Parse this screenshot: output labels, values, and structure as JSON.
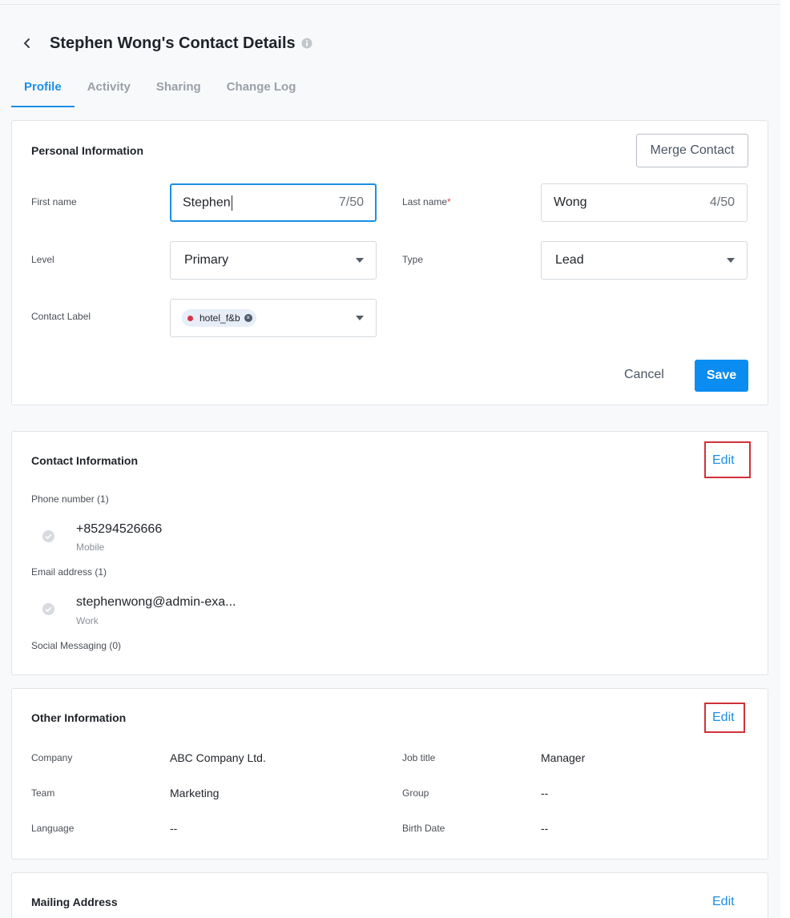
{
  "header": {
    "title": "Stephen Wong's Contact Details"
  },
  "tabs": [
    {
      "label": "Profile",
      "active": true
    },
    {
      "label": "Activity"
    },
    {
      "label": "Sharing"
    },
    {
      "label": "Change Log"
    }
  ],
  "personal": {
    "title": "Personal Information",
    "merge_label": "Merge Contact",
    "first_name": {
      "label": "First name",
      "value": "Stephen",
      "count": "7/50"
    },
    "last_name": {
      "label": "Last name",
      "required": "*",
      "value": "Wong",
      "count": "4/50"
    },
    "level": {
      "label": "Level",
      "value": "Primary"
    },
    "type": {
      "label": "Type",
      "value": "Lead"
    },
    "contact_label": {
      "label": "Contact Label",
      "chip": "hotel_f&b",
      "chip_color": "#d6334a"
    },
    "cancel_label": "Cancel",
    "save_label": "Save"
  },
  "contact": {
    "title": "Contact Information",
    "edit_label": "Edit",
    "phone_header": "Phone number (1)",
    "phone": {
      "value": "+85294526666",
      "type": "Mobile"
    },
    "email_header": "Email address (1)",
    "email": {
      "value": "stephenwong@admin-exa...",
      "type": "Work"
    },
    "social_header": "Social Messaging (0)"
  },
  "other": {
    "title": "Other Information",
    "edit_label": "Edit",
    "company": {
      "label": "Company",
      "value": "ABC Company Ltd."
    },
    "job_title": {
      "label": "Job title",
      "value": "Manager"
    },
    "team": {
      "label": "Team",
      "value": "Marketing"
    },
    "group": {
      "label": "Group",
      "value": "--"
    },
    "language": {
      "label": "Language",
      "value": "--"
    },
    "birth_date": {
      "label": "Birth Date",
      "value": "--"
    }
  },
  "mailing": {
    "title": "Mailing Address",
    "edit_label": "Edit"
  },
  "colors": {
    "accent": "#1b8fe6",
    "primary_button": "#0a8cf0",
    "highlight_box": "#d0323a"
  }
}
